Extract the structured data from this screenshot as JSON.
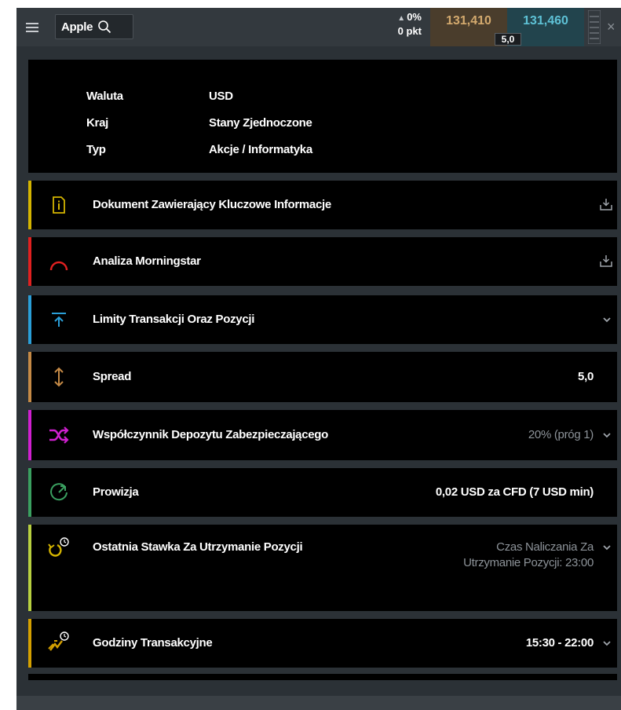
{
  "topbar": {
    "menu_icon": "hamburger-icon",
    "search_text": "Apple",
    "search_icon": "search-icon",
    "change_percent": "0%",
    "change_points": "0 pkt",
    "bid": "131,410",
    "ask": "131,460",
    "spread": "5,0",
    "depth_icon": "depth-bars-icon",
    "close_icon": "close-icon"
  },
  "info": {
    "rows": [
      {
        "key": "Waluta",
        "value": "USD"
      },
      {
        "key": "Kraj",
        "value": "Stany Zjednoczone"
      },
      {
        "key": "Typ",
        "value": "Akcje / Informatyka"
      }
    ]
  },
  "rows": [
    {
      "label": "Dokument Zawierający Kluczowe Informacje",
      "value": "",
      "icon": "document-info-icon",
      "action": "download-icon",
      "accent": "#d4b400"
    },
    {
      "label": "Analiza Morningstar",
      "value": "",
      "icon": "morningstar-icon",
      "action": "download-icon",
      "accent": "#e02020"
    },
    {
      "label": "Limity Transakcji Oraz Pozycji",
      "value": "",
      "icon": "limit-up-icon",
      "action": "chevron-down-icon",
      "accent": "#2a9fd8"
    },
    {
      "label": "Spread",
      "value": "5,0",
      "icon": "spread-arrows-icon",
      "action": "",
      "accent": "#c58a46"
    },
    {
      "label": "Współczynnik Depozytu Zabezpieczającego",
      "value": "20% (próg 1)",
      "icon": "shuffle-icon",
      "action": "chevron-down-icon",
      "accent": "#d020d0"
    },
    {
      "label": "Prowizja",
      "value": "0,02 USD za CFD (7 USD min)",
      "icon": "commission-icon",
      "action": "",
      "accent": "#3aa060"
    },
    {
      "label": "Ostatnia Stawka Za Utrzymanie Pozycji",
      "value": "Czas Naliczania Za Utrzymanie Pozycji: 23:00",
      "icon": "overnight-clock-icon",
      "action": "chevron-down-icon",
      "accent": "#b8d040"
    },
    {
      "label": "Godziny Transakcyjne",
      "value": "15:30 - 22:00",
      "icon": "trading-hours-icon",
      "action": "chevron-down-icon",
      "accent": "#d4a000"
    }
  ],
  "colors": {
    "background": "#2b3136",
    "card": "#000000",
    "bid": "#d4aa6e",
    "ask": "#5ec2d6"
  }
}
